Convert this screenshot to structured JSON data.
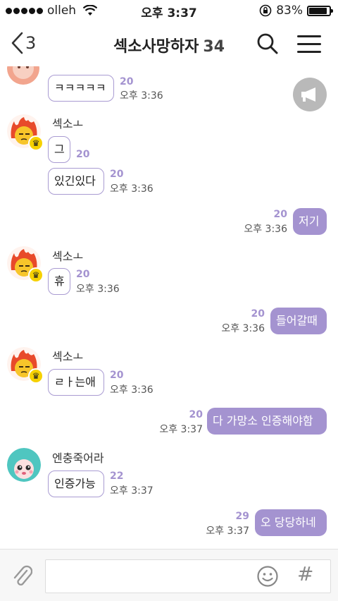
{
  "status_bar": {
    "carrier": "olleh",
    "time": "오후 3:37",
    "battery_percent": "83%",
    "battery_level": 0.83
  },
  "header": {
    "back_count": "3",
    "title": "섹소사망하자",
    "member_count": "34"
  },
  "messages": [
    {
      "side": "in",
      "sender": "",
      "text": "ㅋㅋㅋㅋㅋ",
      "unread": "20",
      "time": "오후 3:36"
    },
    {
      "side": "in",
      "sender": "섹소ㅗ",
      "text": "그",
      "unread": "20",
      "time": ""
    },
    {
      "side": "in",
      "sender": "",
      "text": "있긴있다",
      "unread": "20",
      "time": "오후 3:36"
    },
    {
      "side": "out",
      "text": "저기",
      "unread": "20",
      "time": "오후 3:36"
    },
    {
      "side": "in",
      "sender": "섹소ㅗ",
      "text": "휴",
      "unread": "20",
      "time": "오후 3:36"
    },
    {
      "side": "out",
      "text": "들어갈때",
      "unread": "20",
      "time": "오후 3:36"
    },
    {
      "side": "in",
      "sender": "섹소ㅗ",
      "text": "ㄹㅏ는애",
      "unread": "20",
      "time": "오후 3:36"
    },
    {
      "side": "out",
      "text": "다 가망소 인증해야함",
      "unread": "20",
      "time": "오후 3:37"
    },
    {
      "side": "in",
      "sender": "엔충죽어라",
      "text": "인증가능",
      "unread": "22",
      "time": "오후 3:37"
    },
    {
      "side": "out",
      "text": "오 당당하네",
      "unread": "29",
      "time": "오후 3:37"
    }
  ],
  "icons": {
    "back": "chevron-left-icon",
    "search": "search-icon",
    "menu": "hamburger-menu-icon",
    "notice": "megaphone-icon",
    "attach": "paperclip-icon",
    "emoji": "smiley-icon",
    "hash": "#"
  },
  "colors": {
    "accent": "#a493d0",
    "bubble_border": "#a99bd2",
    "unread": "#a493d0"
  }
}
